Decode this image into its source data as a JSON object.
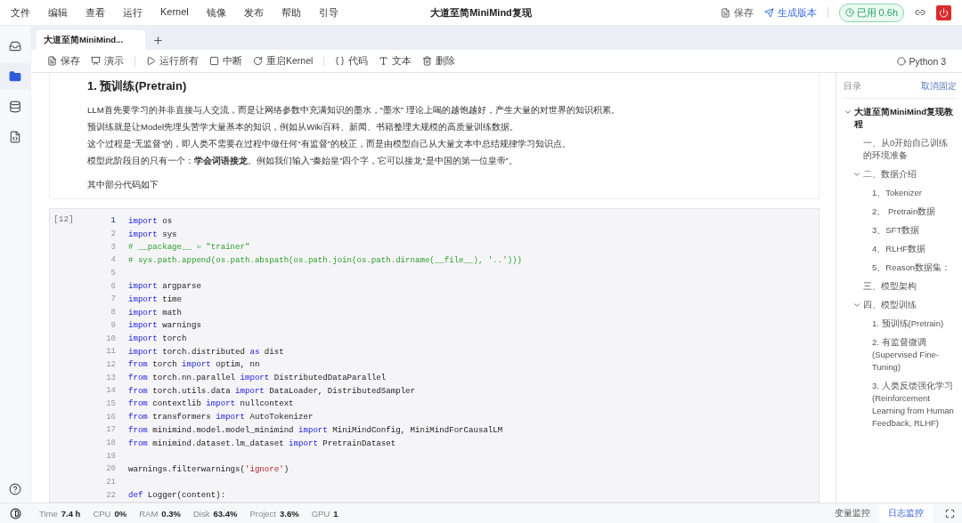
{
  "menu": [
    "文件",
    "编辑",
    "查看",
    "运行",
    "Kernel",
    "镜像",
    "发布",
    "帮助",
    "引导"
  ],
  "title": "大道至简MiniMind复现",
  "header_actions": {
    "save": "保存",
    "publish": "生成版本",
    "usage": "已用 0.6h"
  },
  "sidebar": [
    {
      "kind": "inbox",
      "selected": false
    },
    {
      "kind": "folder",
      "selected": true
    },
    {
      "kind": "database",
      "selected": false
    },
    {
      "kind": "code",
      "selected": false
    }
  ],
  "sidebar_bottom": [
    {
      "kind": "help"
    },
    {
      "kind": "theme"
    }
  ],
  "tabs": [
    {
      "label": "大道至简MiniMind...",
      "selected": true
    }
  ],
  "toolbar": [
    {
      "kind": "save",
      "label": "保存"
    },
    {
      "kind": "present",
      "label": "演示"
    },
    {
      "kind": "sep"
    },
    {
      "kind": "run",
      "label": "运行所有"
    },
    {
      "kind": "stop",
      "label": "中断"
    },
    {
      "kind": "restart",
      "label": "重启Kernel"
    },
    {
      "kind": "sep"
    },
    {
      "kind": "code",
      "label": "代码"
    },
    {
      "kind": "text",
      "label": "文本"
    },
    {
      "kind": "delete",
      "label": "删除"
    }
  ],
  "kernel": "Python 3",
  "markdown": {
    "heading": "1. 预训练(Pretrain)",
    "paragraphs": [
      "LLM首先要学习的并非直接与人交流，而是让网络参数中充满知识的墨水，“墨水” 理论上喝的越饱越好，产生大量的对世界的知识积累。",
      "预训练就是让Model先埋头苦学大量基本的知识，例如从Wiki百科、新闻、书籍整理大规模的高质量训练数据。",
      "这个过程是“无监督”的，即人类不需要在过程中做任何“有监督”的校正，而是由模型自己从大量文本中总结规律学习知识点。",
      "模型此阶段目的只有一个：**学会词语接龙**。例如我们输入“秦始皇”四个字，它可以接龙“是中国的第一位皇帝”。"
    ],
    "footer": "其中部分代码如下"
  },
  "code_cell": {
    "prompt": "[12]",
    "lines": [
      {
        "number": "1",
        "active": true,
        "tokens": [
          {
            "kind": "kw",
            "text": "import"
          },
          {
            "kind": "plain",
            "text": " os"
          }
        ]
      },
      {
        "number": "2",
        "active": false,
        "tokens": [
          {
            "kind": "kw",
            "text": "import"
          },
          {
            "kind": "plain",
            "text": " sys"
          }
        ]
      },
      {
        "number": "3",
        "active": false,
        "tokens": [
          {
            "kind": "comment",
            "text": "# __package__ = \"trainer\""
          }
        ]
      },
      {
        "number": "4",
        "active": false,
        "tokens": [
          {
            "kind": "comment",
            "text": "# sys.path.append(os.path.abspath(os.path.join(os.path.dirname(__file__), '..')))"
          }
        ]
      },
      {
        "number": "5",
        "active": false
      },
      {
        "number": "6",
        "active": false,
        "tokens": [
          {
            "kind": "kw",
            "text": "import"
          },
          {
            "kind": "plain",
            "text": " argparse"
          }
        ]
      },
      {
        "number": "7",
        "active": false,
        "tokens": [
          {
            "kind": "kw",
            "text": "import"
          },
          {
            "kind": "plain",
            "text": " time"
          }
        ]
      },
      {
        "number": "8",
        "active": false,
        "tokens": [
          {
            "kind": "kw",
            "text": "import"
          },
          {
            "kind": "plain",
            "text": " math"
          }
        ]
      },
      {
        "number": "9",
        "active": false,
        "tokens": [
          {
            "kind": "kw",
            "text": "import"
          },
          {
            "kind": "plain",
            "text": " warnings"
          }
        ]
      },
      {
        "number": "10",
        "active": false,
        "tokens": [
          {
            "kind": "kw",
            "text": "import"
          },
          {
            "kind": "plain",
            "text": " torch"
          }
        ]
      },
      {
        "number": "11",
        "active": false,
        "tokens": [
          {
            "kind": "kw",
            "text": "import"
          },
          {
            "kind": "plain",
            "text": " torch.distributed "
          },
          {
            "kind": "kw",
            "text": "as"
          },
          {
            "kind": "plain",
            "text": " dist"
          }
        ]
      },
      {
        "number": "12",
        "active": false,
        "tokens": [
          {
            "kind": "kw",
            "text": "from"
          },
          {
            "kind": "plain",
            "text": " torch "
          },
          {
            "kind": "kw",
            "text": "import"
          },
          {
            "kind": "plain",
            "text": " optim, nn"
          }
        ]
      },
      {
        "number": "13",
        "active": false,
        "tokens": [
          {
            "kind": "kw",
            "text": "from"
          },
          {
            "kind": "plain",
            "text": " torch.nn.parallel "
          },
          {
            "kind": "kw",
            "text": "import"
          },
          {
            "kind": "plain",
            "text": " DistributedDataParallel"
          }
        ]
      },
      {
        "number": "14",
        "active": false,
        "tokens": [
          {
            "kind": "kw",
            "text": "from"
          },
          {
            "kind": "plain",
            "text": " torch.utils.data "
          },
          {
            "kind": "kw",
            "text": "import"
          },
          {
            "kind": "plain",
            "text": " DataLoader, DistributedSampler"
          }
        ]
      },
      {
        "number": "15",
        "active": false,
        "tokens": [
          {
            "kind": "kw",
            "text": "from"
          },
          {
            "kind": "plain",
            "text": " contextlib "
          },
          {
            "kind": "kw",
            "text": "import"
          },
          {
            "kind": "plain",
            "text": " nullcontext"
          }
        ]
      },
      {
        "number": "16",
        "active": false,
        "tokens": [
          {
            "kind": "kw",
            "text": "from"
          },
          {
            "kind": "plain",
            "text": " transformers "
          },
          {
            "kind": "kw",
            "text": "import"
          },
          {
            "kind": "plain",
            "text": " AutoTokenizer"
          }
        ]
      },
      {
        "number": "17",
        "active": false,
        "tokens": [
          {
            "kind": "kw",
            "text": "from"
          },
          {
            "kind": "plain",
            "text": " minimind.model.model_minimind "
          },
          {
            "kind": "kw",
            "text": "import"
          },
          {
            "kind": "plain",
            "text": " MiniMindConfig, MiniMindForCausalLM"
          }
        ]
      },
      {
        "number": "18",
        "active": false,
        "tokens": [
          {
            "kind": "kw",
            "text": "from"
          },
          {
            "kind": "plain",
            "text": " minimind.dataset.lm_dataset "
          },
          {
            "kind": "kw",
            "text": "import"
          },
          {
            "kind": "plain",
            "text": " PretrainDataset"
          }
        ]
      },
      {
        "number": "19",
        "active": false
      },
      {
        "number": "20",
        "active": false,
        "tokens": [
          {
            "kind": "plain",
            "text": "warnings.filterwarnings("
          },
          {
            "kind": "str",
            "text": "'ignore'"
          },
          {
            "kind": "plain",
            "text": ")"
          }
        ]
      },
      {
        "number": "21",
        "active": false
      },
      {
        "number": "22",
        "active": false,
        "tokens": [
          {
            "kind": "kw",
            "text": "def"
          },
          {
            "kind": "plain",
            "text": " Logger(content):"
          }
        ]
      }
    ]
  },
  "toc": {
    "title": "目录",
    "unpin": "取消固定",
    "items": [
      {
        "label": "大道至简MiniMind复现教程",
        "expanded": true,
        "children": [
          {
            "label": "一、从0开始自己训练的环境准备"
          },
          {
            "label": "二、数据介绍",
            "expanded": true,
            "children": [
              {
                "label": "1、Tokenizer"
              },
              {
                "label": "2、 Pretrain数据"
              },
              {
                "label": "3、SFT数据"
              },
              {
                "label": "4、RLHF数据"
              },
              {
                "label": "5、Reason数据集："
              }
            ]
          },
          {
            "label": "三、模型架构"
          },
          {
            "label": "四、模型训练",
            "expanded": true,
            "children": [
              {
                "label": "1. 预训练(Pretrain)"
              },
              {
                "label": "2. 有监督微调(Supervised Fine-Tuning)"
              },
              {
                "label": "3. 人类反馈强化学习(Reinforcement Learning from Human Feedback, RLHF)"
              }
            ]
          }
        ]
      }
    ]
  },
  "status_bar": [
    {
      "label": "Time",
      "value": "7.4 h"
    },
    {
      "label": "CPU",
      "value": "0%"
    },
    {
      "label": "RAM",
      "value": "0.3%"
    },
    {
      "label": "Disk",
      "value": "63.4%"
    },
    {
      "label": "Project",
      "value": "3.6%"
    },
    {
      "label": "GPU",
      "value": "1"
    }
  ],
  "monitor_tabs": [
    {
      "label": "变量监控",
      "selected": false
    },
    {
      "label": "日志监控",
      "selected": true
    }
  ]
}
